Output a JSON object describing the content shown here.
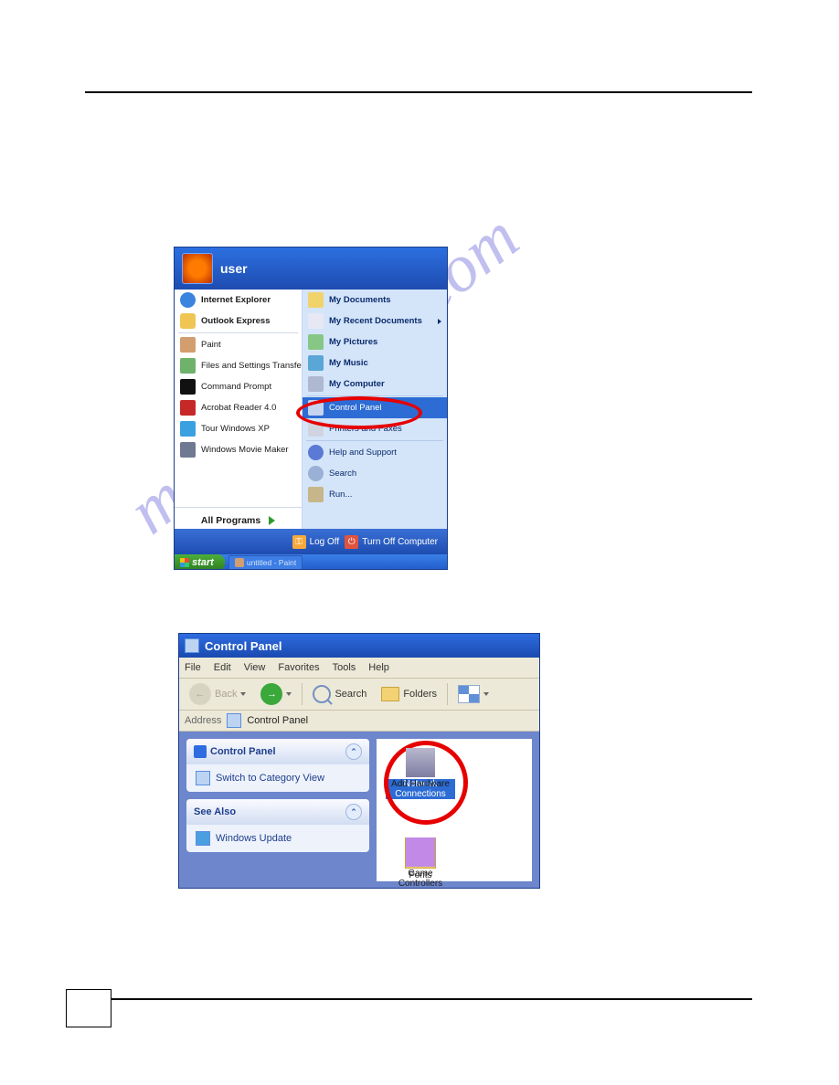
{
  "start_menu": {
    "username": "user",
    "left_pinned": [
      {
        "label": "Internet Explorer",
        "icon": "ie"
      },
      {
        "label": "Outlook Express",
        "icon": "ol"
      }
    ],
    "left_recent": [
      {
        "label": "Paint",
        "icon": "paint"
      },
      {
        "label": "Files and Settings Transfer W...",
        "icon": "fst"
      },
      {
        "label": "Command Prompt",
        "icon": "cmd"
      },
      {
        "label": "Acrobat Reader 4.0",
        "icon": "pdf"
      },
      {
        "label": "Tour Windows XP",
        "icon": "tour"
      },
      {
        "label": "Windows Movie Maker",
        "icon": "wmm"
      }
    ],
    "all_programs": "All Programs",
    "right_top": [
      {
        "label": "My Documents",
        "icon": "docs",
        "bold": true
      },
      {
        "label": "My Recent Documents",
        "icon": "recent",
        "bold": true,
        "submenu": true
      },
      {
        "label": "My Pictures",
        "icon": "pic",
        "bold": true
      },
      {
        "label": "My Music",
        "icon": "music",
        "bold": true
      },
      {
        "label": "My Computer",
        "icon": "comp",
        "bold": true
      }
    ],
    "right_mid_highlight": {
      "label": "Control Panel",
      "icon": "cp"
    },
    "right_mid": [
      {
        "label": "Printers and Faxes",
        "icon": "print"
      }
    ],
    "right_bot": [
      {
        "label": "Help and Support",
        "icon": "help"
      },
      {
        "label": "Search",
        "icon": "search"
      },
      {
        "label": "Run...",
        "icon": "run"
      }
    ],
    "log_off": "Log Off",
    "turn_off": "Turn Off Computer",
    "start_button": "start",
    "taskbar_item": "untitled - Paint"
  },
  "control_panel": {
    "title": "Control Panel",
    "menus": [
      "File",
      "Edit",
      "View",
      "Favorites",
      "Tools",
      "Help"
    ],
    "toolbar": {
      "back": "Back",
      "search": "Search",
      "folders": "Folders"
    },
    "address_label": "Address",
    "address_value": "Control Panel",
    "side_panel_title": "Control Panel",
    "side_link": "Switch to Category View",
    "see_also_title": "See Also",
    "see_also_link": "Windows Update",
    "items": {
      "network": "Network Connections",
      "hardware": "Add Hardware",
      "fonts": "Fonts",
      "game": "Game Controllers"
    }
  },
  "watermark": "manualshive.com"
}
